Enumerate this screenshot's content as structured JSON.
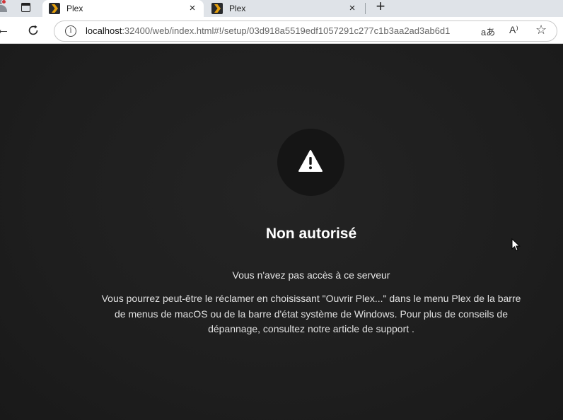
{
  "browser": {
    "tabs": [
      {
        "title": "Plex",
        "active": true
      },
      {
        "title": "Plex",
        "active": false
      }
    ],
    "tab_close_glyph": "×",
    "new_tab_glyph": "+",
    "url": {
      "host": "localhost",
      "rest": ":32400/web/index.html#!/setup/03d918a5519edf1057291c277c1b3aa2ad3ab6d1"
    },
    "icons": {
      "back": "back-arrow-icon",
      "reload": "reload-icon",
      "site_info": "info-icon",
      "translate": "translate-icon",
      "read_aloud": "read-aloud-icon",
      "favorite": "star-icon"
    },
    "icon_glyphs": {
      "back": "←",
      "info": "i",
      "translate": "aあ",
      "read_aloud": "A⁾",
      "star": "☆"
    }
  },
  "error": {
    "title": "Non autorisé",
    "subtitle": "Vous n'avez pas accès à ce serveur",
    "message": "Vous pourrez peut-être le réclamer en choisissant \"Ouvrir Plex...\" dans le menu Plex de la barre de menus de macOS ou de la barre d'état système de Windows. Pour plus de conseils de dépannage, consultez notre article de support ."
  },
  "colors": {
    "background": "#1f1f1f",
    "icon_circle": "#151515",
    "plex_orange": "#e5a00d",
    "text": "#ffffff"
  }
}
